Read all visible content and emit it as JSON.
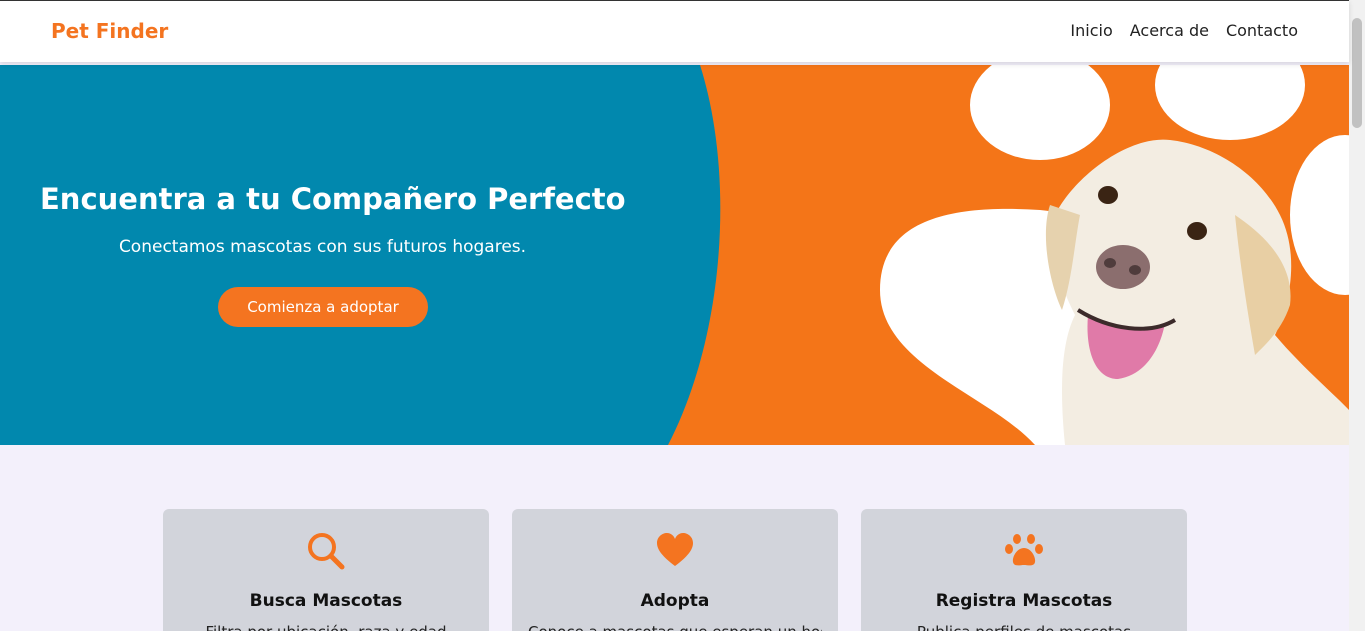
{
  "navbar": {
    "brand": "Pet Finder",
    "links": [
      "Inicio",
      "Acerca de",
      "Contacto"
    ]
  },
  "hero": {
    "title": "Encuentra a tu Compañero Perfecto",
    "subtitle": "Conectamos mascotas con sus futuros hogares.",
    "button_label": "Comienza a adoptar"
  },
  "features": [
    {
      "icon": "search-icon",
      "title": "Busca Mascotas",
      "text": "Filtra por ubicación, raza y edad"
    },
    {
      "icon": "heart-icon",
      "title": "Adopta",
      "text": "Conoce a mascotas que esperan un hogar"
    },
    {
      "icon": "paw-icon",
      "title": "Registra Mascotas",
      "text": "Publica perfiles de mascotas"
    }
  ],
  "colors": {
    "accent": "#f47420",
    "hero_blue": "#0188ae",
    "hero_orange": "#f47518",
    "section_bg": "#f3f0fb",
    "card_bg": "#d2d4db"
  }
}
